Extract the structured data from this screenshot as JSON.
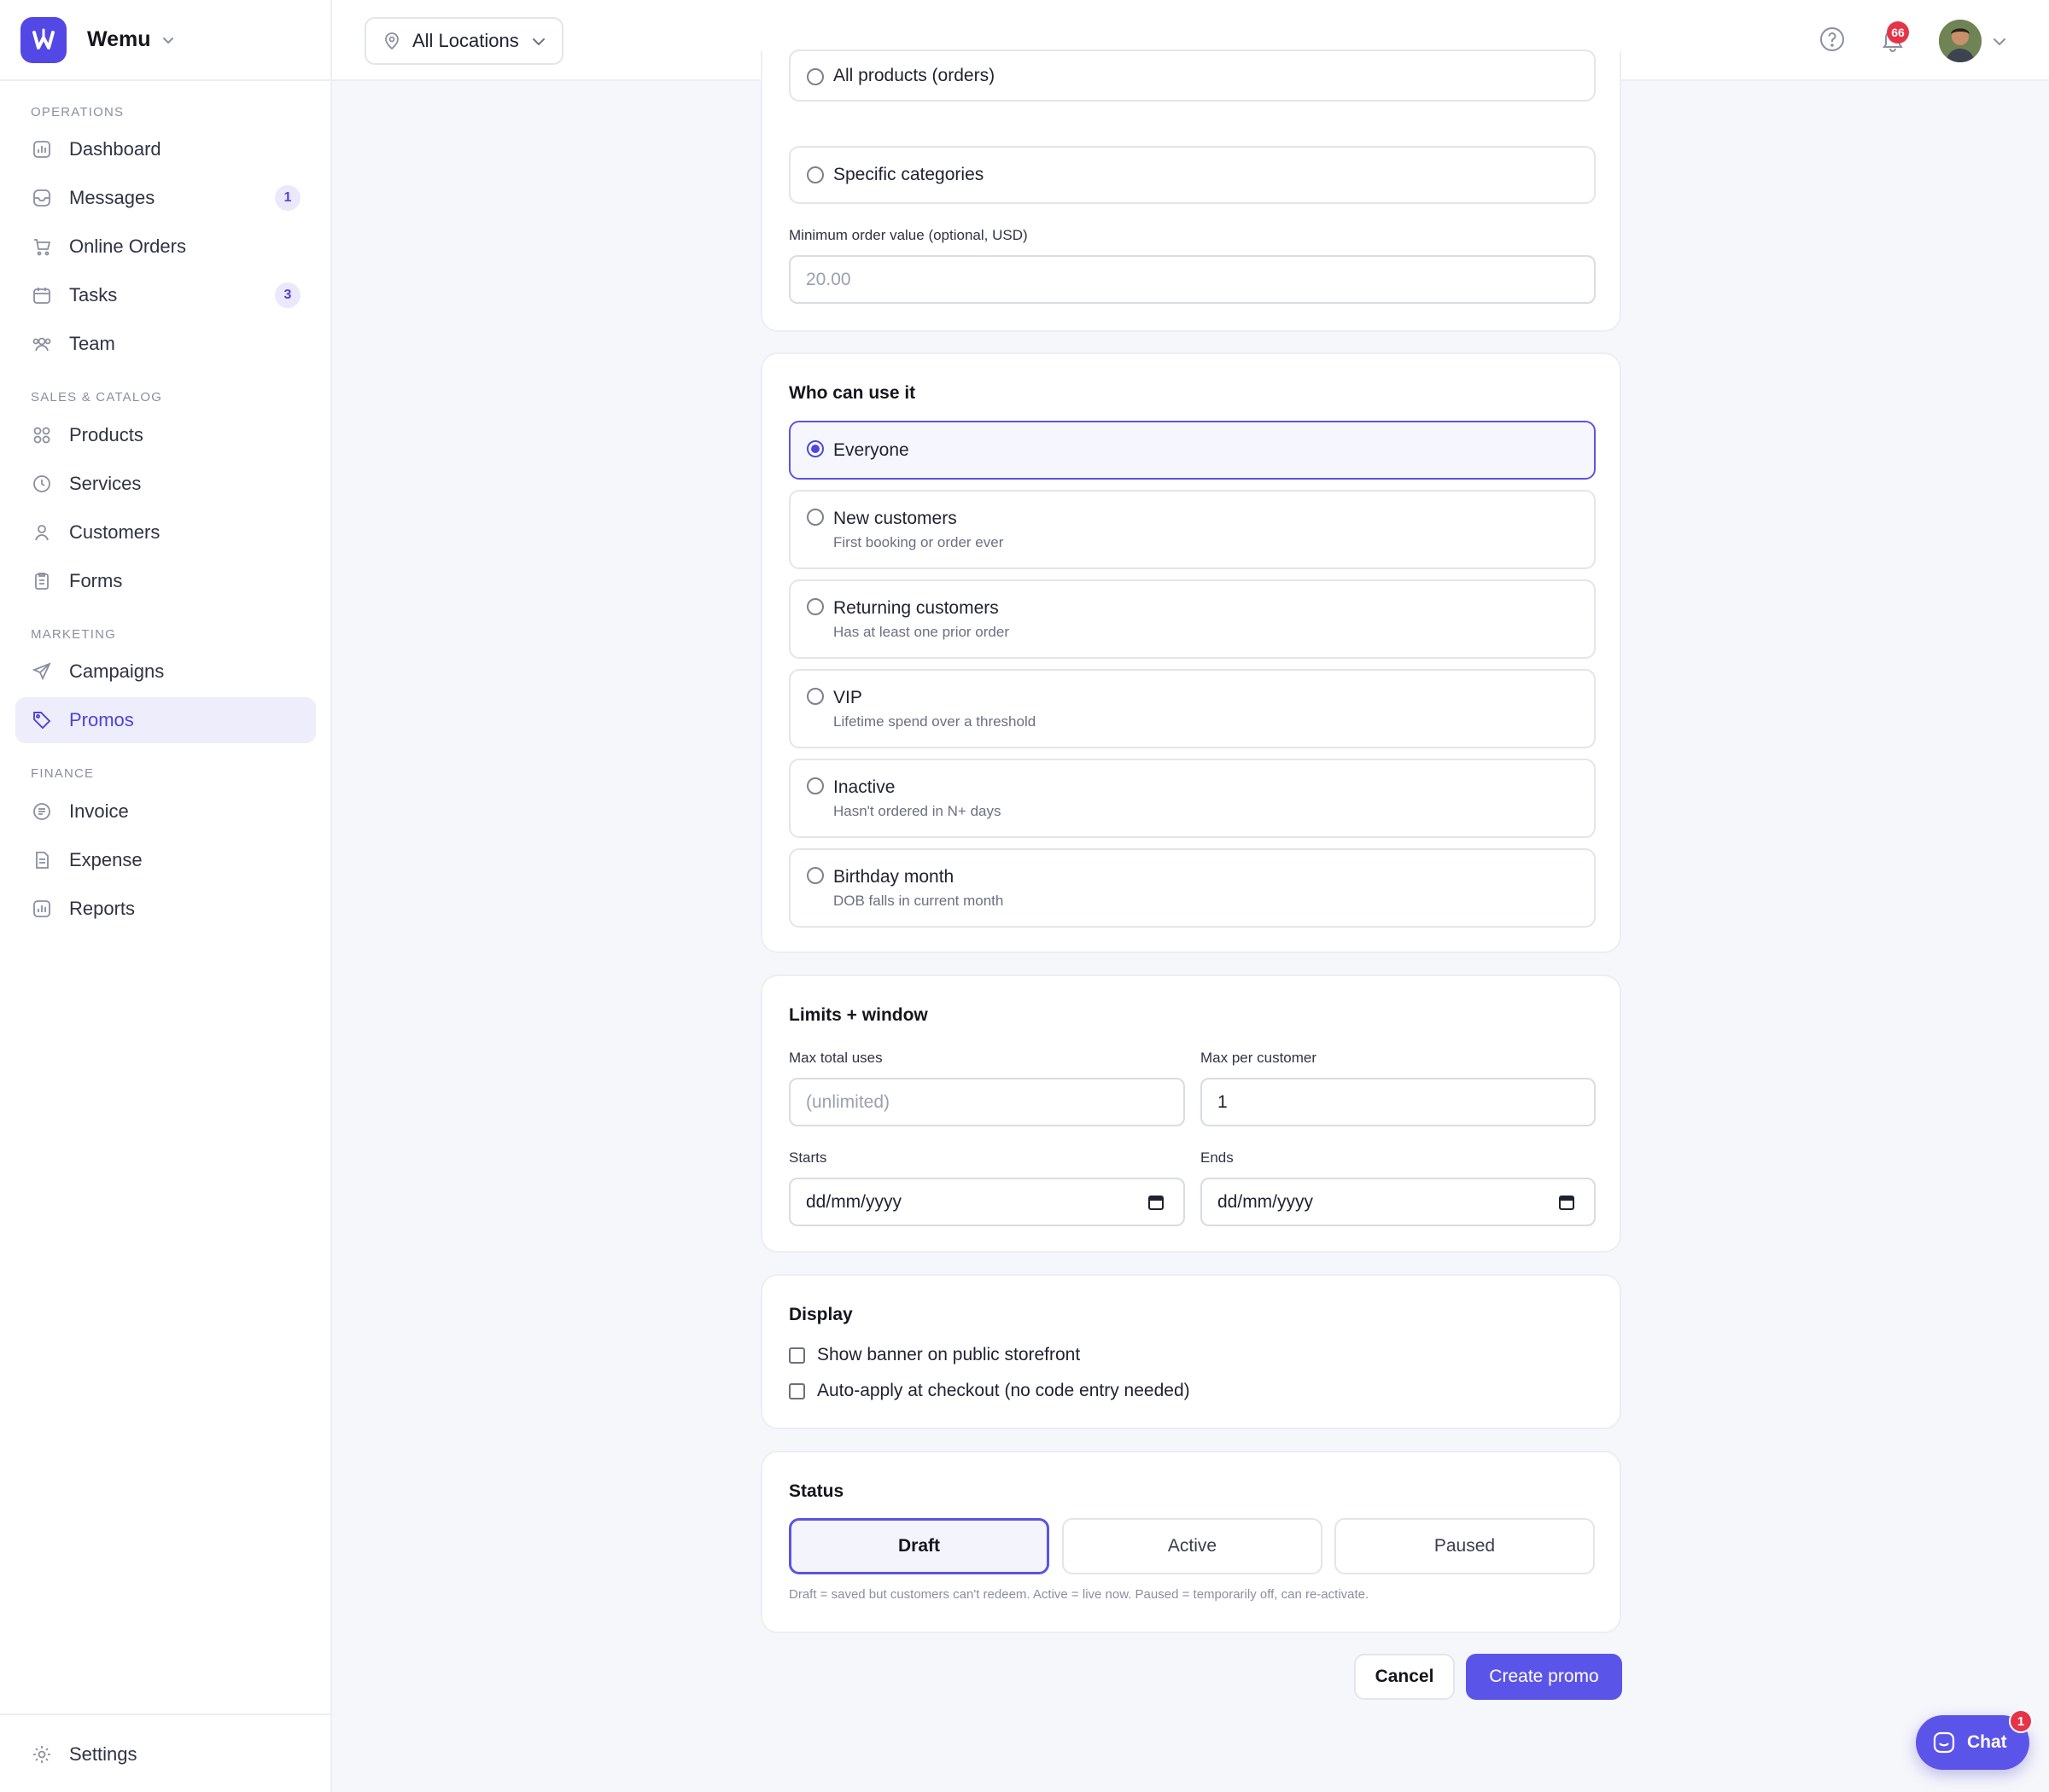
{
  "brand": {
    "name": "Wemu"
  },
  "sidebar": {
    "sections": [
      {
        "title": "OPERATIONS",
        "items": [
          {
            "label": "Dashboard",
            "icon": "chart-icon"
          },
          {
            "label": "Messages",
            "icon": "inbox-icon",
            "badge": "1"
          },
          {
            "label": "Online Orders",
            "icon": "cart-icon"
          },
          {
            "label": "Tasks",
            "icon": "calendar-icon",
            "badge": "3"
          },
          {
            "label": "Team",
            "icon": "team-icon"
          }
        ]
      },
      {
        "title": "SALES & CATALOG",
        "items": [
          {
            "label": "Products",
            "icon": "grid-icon"
          },
          {
            "label": "Services",
            "icon": "clock-icon"
          },
          {
            "label": "Customers",
            "icon": "user-icon"
          },
          {
            "label": "Forms",
            "icon": "clipboard-icon"
          }
        ]
      },
      {
        "title": "MARKETING",
        "items": [
          {
            "label": "Campaigns",
            "icon": "send-icon"
          },
          {
            "label": "Promos",
            "icon": "tag-icon",
            "active": true
          }
        ]
      },
      {
        "title": "FINANCE",
        "items": [
          {
            "label": "Invoice",
            "icon": "invoice-icon"
          },
          {
            "label": "Expense",
            "icon": "expense-icon"
          },
          {
            "label": "Reports",
            "icon": "reports-icon"
          }
        ]
      }
    ],
    "settings_label": "Settings"
  },
  "header": {
    "location_label": "All Locations",
    "notification_count": "66"
  },
  "applies_to": {
    "options": [
      {
        "label": "All products (orders)"
      },
      {
        "label": "Specific categories"
      }
    ],
    "min_order_label": "Minimum order value (optional, USD)",
    "min_order_placeholder": "20.00"
  },
  "audience": {
    "title": "Who can use it",
    "selected": "Everyone",
    "options": [
      {
        "label": "Everyone",
        "sub": ""
      },
      {
        "label": "New customers",
        "sub": "First booking or order ever"
      },
      {
        "label": "Returning customers",
        "sub": "Has at least one prior order"
      },
      {
        "label": "VIP",
        "sub": "Lifetime spend over a threshold"
      },
      {
        "label": "Inactive",
        "sub": "Hasn't ordered in N+ days"
      },
      {
        "label": "Birthday month",
        "sub": "DOB falls in current month"
      }
    ]
  },
  "limits": {
    "title": "Limits + window",
    "max_total_label": "Max total uses",
    "max_total_placeholder": "(unlimited)",
    "max_per_customer_label": "Max per customer",
    "max_per_customer_value": "1",
    "starts_label": "Starts",
    "starts_value": "dd/mm/yyyy",
    "ends_label": "Ends",
    "ends_value": "dd/mm/yyyy"
  },
  "display": {
    "title": "Display",
    "options": [
      {
        "label": "Show banner on public storefront",
        "checked": false
      },
      {
        "label": "Auto-apply at checkout (no code entry needed)",
        "checked": false
      }
    ]
  },
  "status": {
    "title": "Status",
    "options": [
      "Draft",
      "Active",
      "Paused"
    ],
    "selected": "Draft",
    "hint": "Draft = saved but customers can't redeem. Active = live now. Paused = temporarily off, can re-activate."
  },
  "actions": {
    "cancel": "Cancel",
    "create": "Create promo"
  },
  "chat": {
    "label": "Chat",
    "badge": "1"
  },
  "colors": {
    "accent": "#5b54e8",
    "badge_red": "#e53448",
    "active_bg": "#eeedfb"
  }
}
